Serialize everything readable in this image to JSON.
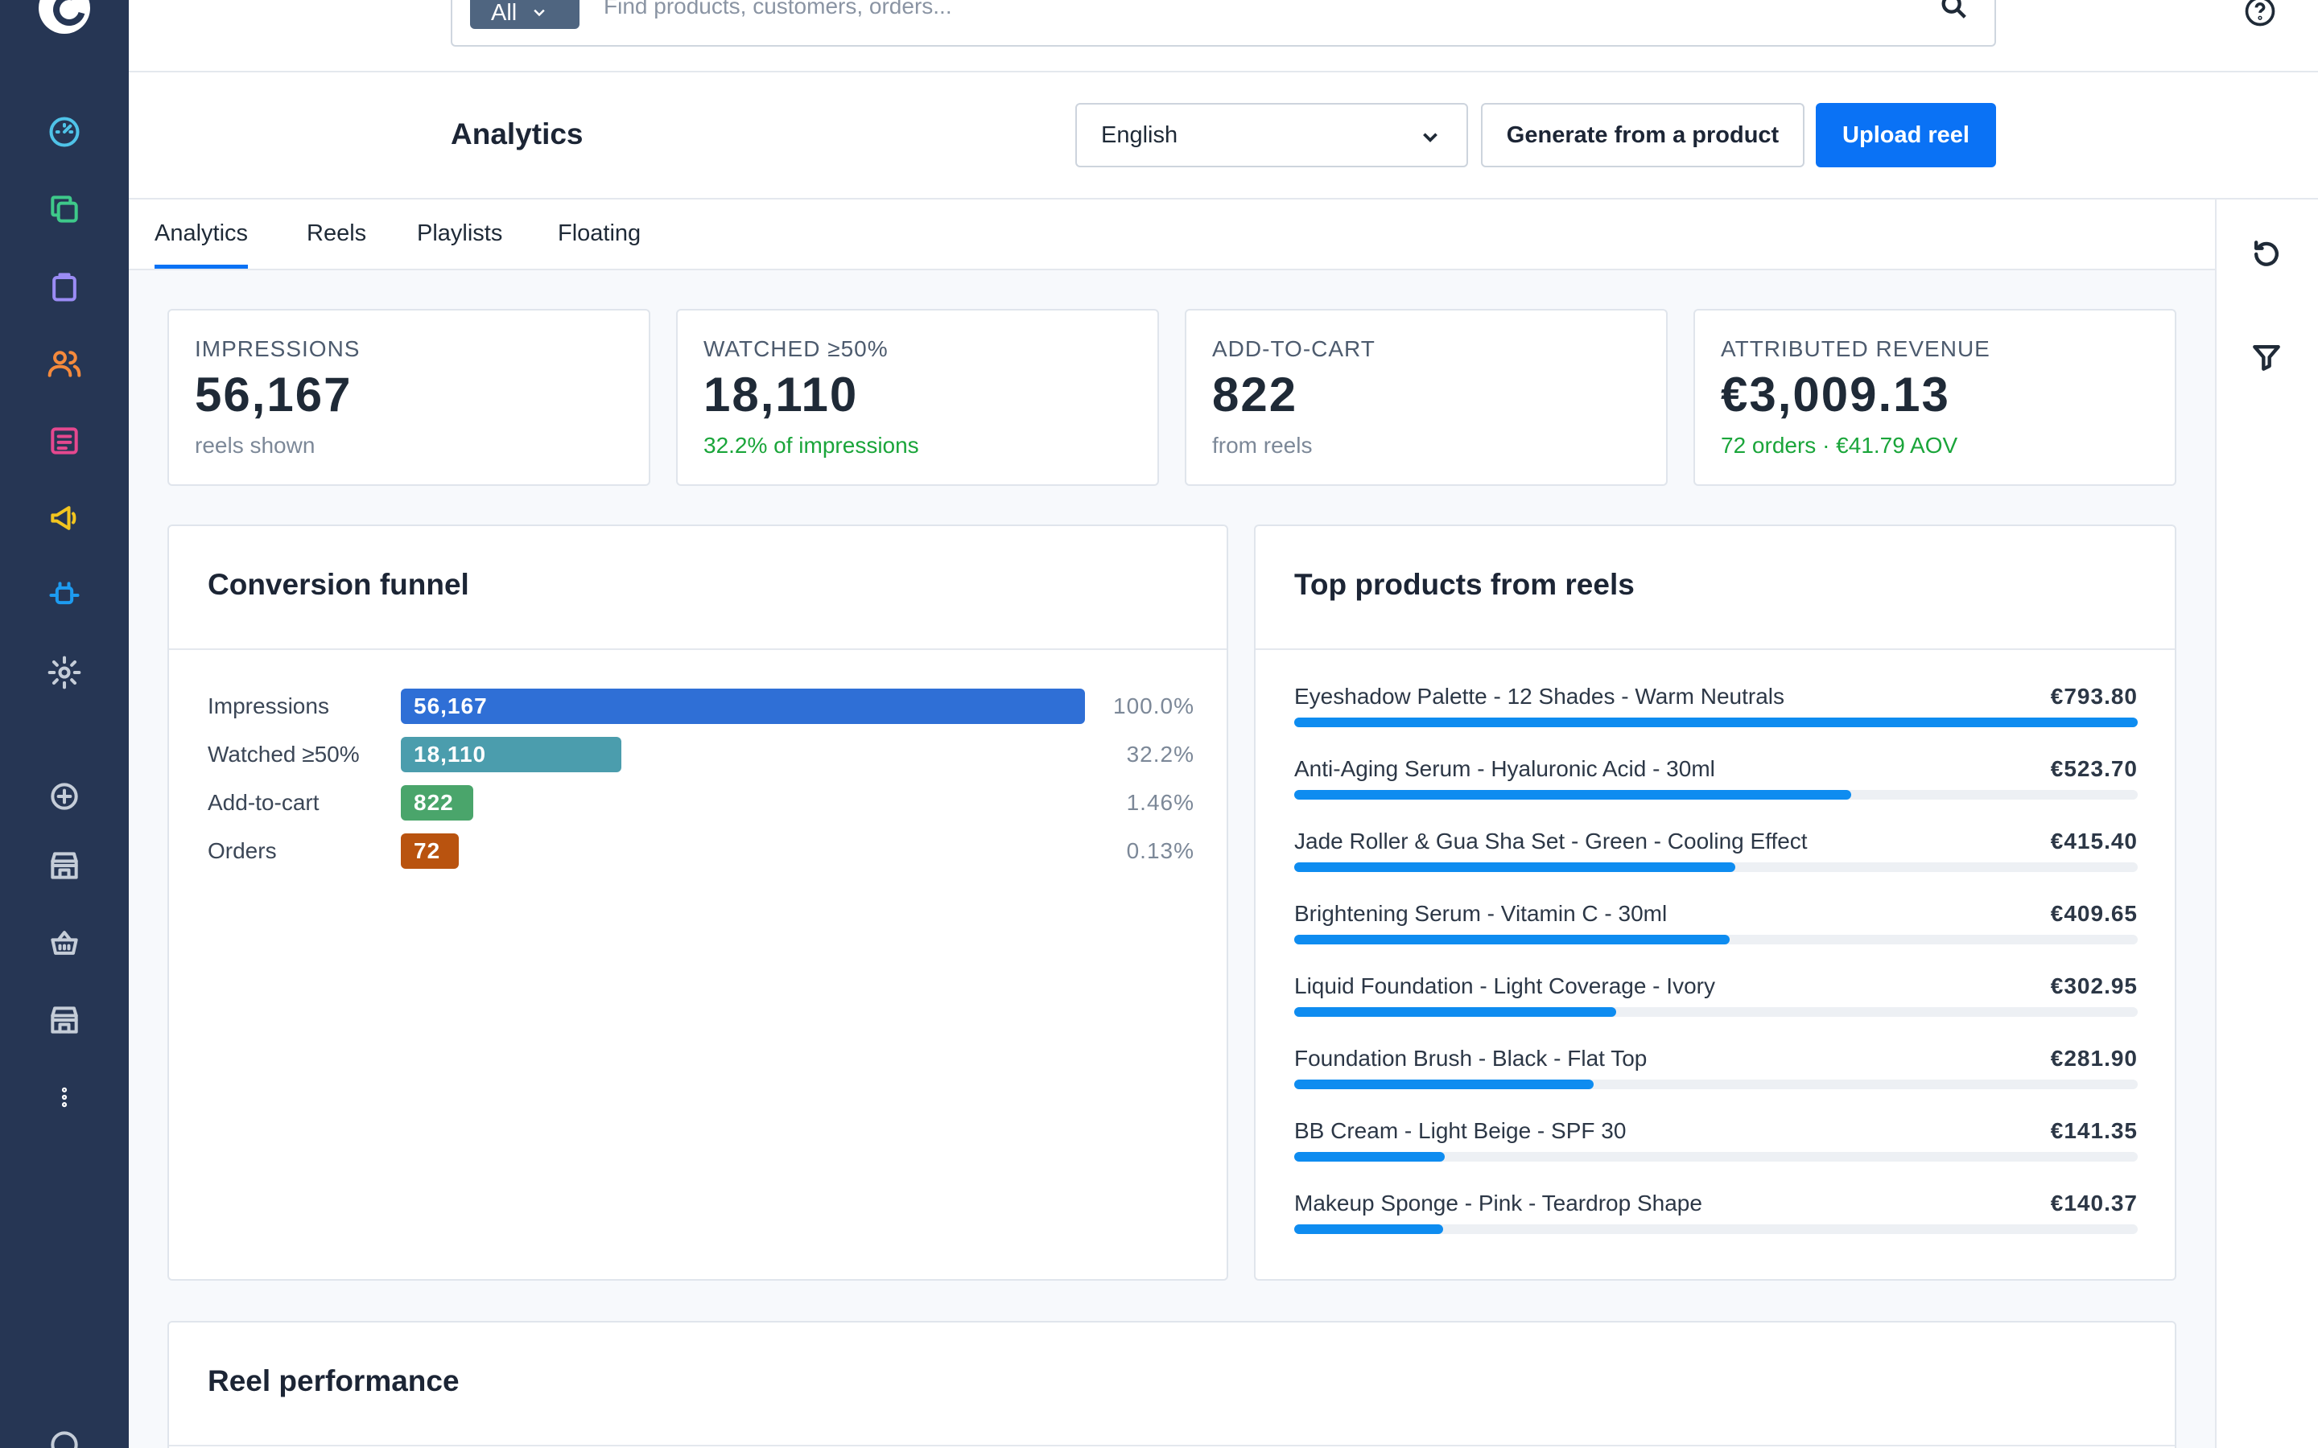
{
  "search": {
    "scope_label": "All",
    "placeholder": "Find products, customers, orders..."
  },
  "header": {
    "title": "Analytics",
    "language": "English",
    "generate_label": "Generate from a product",
    "upload_label": "Upload reel"
  },
  "tabs": [
    {
      "label": "Analytics",
      "active": true
    },
    {
      "label": "Reels",
      "active": false
    },
    {
      "label": "Playlists",
      "active": false
    },
    {
      "label": "Floating",
      "active": false
    }
  ],
  "kpis": [
    {
      "label": "IMPRESSIONS",
      "value": "56,167",
      "sub": "reels shown"
    },
    {
      "label": "WATCHED ≥50%",
      "value": "18,110",
      "sub": "32.2% of impressions"
    },
    {
      "label": "ADD-TO-CART",
      "value": "822",
      "sub": "from reels"
    },
    {
      "label": "ATTRIBUTED REVENUE",
      "value": "€3,009.13",
      "sub": "72 orders · €41.79 AOV"
    }
  ],
  "funnel": {
    "title": "Conversion funnel",
    "rows": [
      {
        "label": "Impressions",
        "value": "56,167",
        "pct": "100.0%",
        "fraction": 1.0,
        "color": "#2f6fd6"
      },
      {
        "label": "Watched ≥50%",
        "value": "18,110",
        "pct": "32.2%",
        "fraction": 0.322,
        "color": "#4b9dad"
      },
      {
        "label": "Add-to-cart",
        "value": "822",
        "pct": "1.46%",
        "fraction": 0.0146,
        "color": "#4aa56b"
      },
      {
        "label": "Orders",
        "value": "72",
        "pct": "0.13%",
        "fraction": 0.0013,
        "color": "#b9530f"
      }
    ]
  },
  "top_products": {
    "title": "Top products from reels",
    "items": [
      {
        "name": "Eyeshadow Palette - 12 Shades - Warm Neutrals",
        "value": "€793.80",
        "fraction": 1.0
      },
      {
        "name": "Anti-Aging Serum - Hyaluronic Acid - 30ml",
        "value": "€523.70",
        "fraction": 0.66
      },
      {
        "name": "Jade Roller & Gua Sha Set - Green - Cooling Effect",
        "value": "€415.40",
        "fraction": 0.523
      },
      {
        "name": "Brightening Serum - Vitamin C - 30ml",
        "value": "€409.65",
        "fraction": 0.516
      },
      {
        "name": "Liquid Foundation - Light Coverage - Ivory",
        "value": "€302.95",
        "fraction": 0.382
      },
      {
        "name": "Foundation Brush - Black - Flat Top",
        "value": "€281.90",
        "fraction": 0.355
      },
      {
        "name": "BB Cream - Light Beige - SPF 30",
        "value": "€141.35",
        "fraction": 0.178
      },
      {
        "name": "Makeup Sponge - Pink - Teardrop Shape",
        "value": "€140.37",
        "fraction": 0.177
      }
    ]
  },
  "reel_performance": {
    "title": "Reel performance"
  },
  "sidebar": {
    "icons": [
      "dashboard-icon",
      "layers-icon",
      "orders-icon",
      "customers-icon",
      "catalog-icon",
      "marketing-icon",
      "integrations-icon",
      "settings-icon",
      "add-channel-icon",
      "store-icon",
      "basket-icon",
      "shop-icon",
      "more-icon",
      "clock-icon"
    ]
  },
  "colors": {
    "accent": "#0a72f5",
    "sidebar_bg": "#263654",
    "bar_blue": "#0e8cf0",
    "positive": "#1aa53a"
  }
}
